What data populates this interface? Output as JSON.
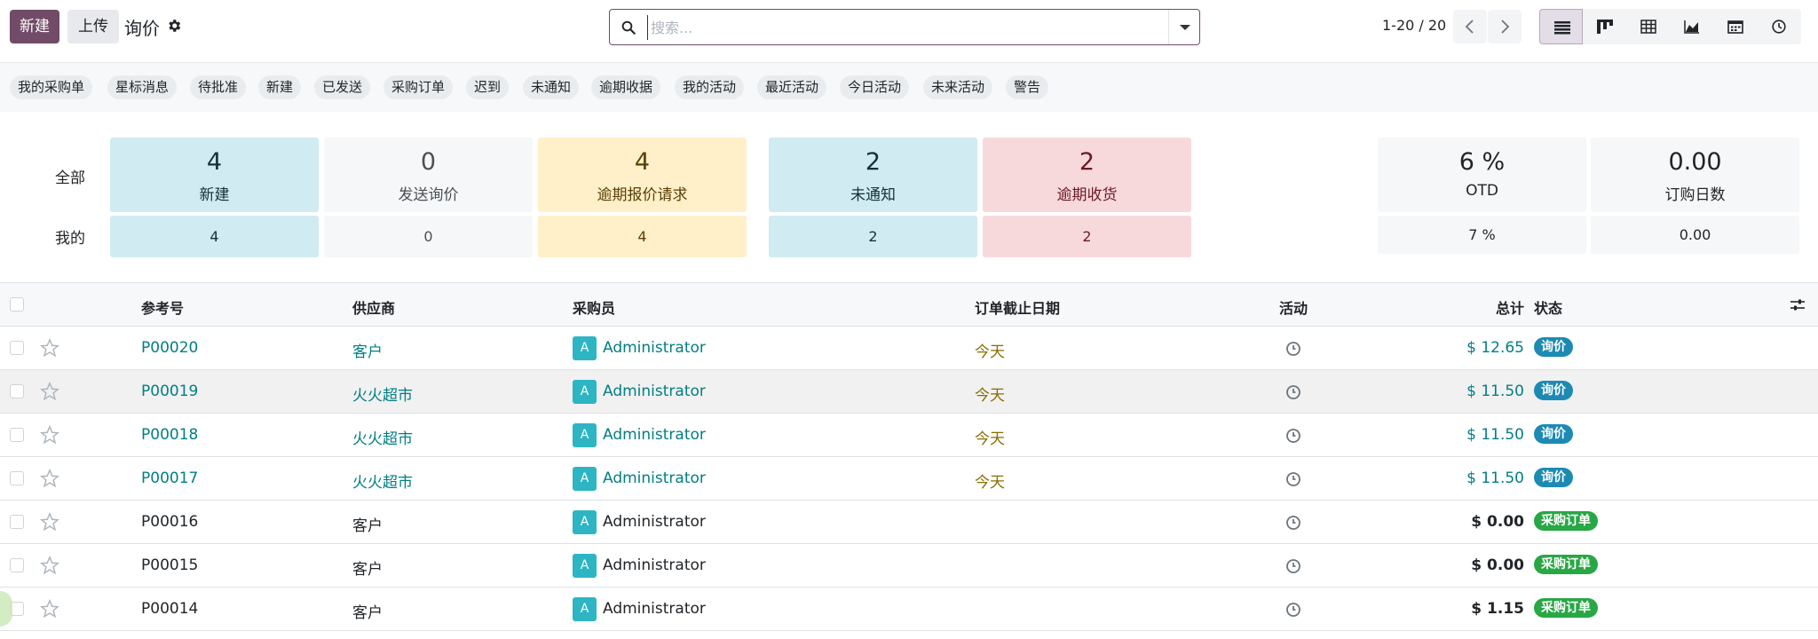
{
  "toolbar": {
    "new_label": "新建",
    "upload_label": "上传",
    "title": "询价"
  },
  "search": {
    "placeholder": "搜索..."
  },
  "pager": {
    "range": "1-20 / 20"
  },
  "views": [
    "list-view-icon",
    "kanban-view-icon",
    "pivot-view-icon",
    "graph-view-icon",
    "calendar-view-icon",
    "activity-view-icon"
  ],
  "filters": [
    "我的采购单",
    "星标消息",
    "待批准",
    "新建",
    "已发送",
    "采购订单",
    "迟到",
    "未通知",
    "逾期收据",
    "我的活动",
    "最近活动",
    "今日活动",
    "未来活动",
    "警告"
  ],
  "dashboard": {
    "all_label": "全部",
    "mine_label": "我的",
    "tiles": [
      {
        "all": "4",
        "label": "新建",
        "mine": "4",
        "tone": "blue"
      },
      {
        "all": "0",
        "label": "发送询价",
        "mine": "0",
        "tone": "gray"
      },
      {
        "all": "4",
        "label": "逾期报价请求",
        "mine": "4",
        "tone": "yellow"
      },
      {
        "all": "2",
        "label": "未通知",
        "mine": "2",
        "tone": "blue"
      },
      {
        "all": "2",
        "label": "逾期收货",
        "mine": "2",
        "tone": "red"
      }
    ],
    "stats": [
      {
        "all": "6 %",
        "label": "OTD",
        "mine": "7 %"
      },
      {
        "all": "0.00",
        "label": "订购日数",
        "mine": "0.00"
      }
    ]
  },
  "table": {
    "headers": {
      "ref": "参考号",
      "vendor": "供应商",
      "buyer": "采购员",
      "deadline": "订单截止日期",
      "activity": "活动",
      "total": "总计",
      "status": "状态"
    },
    "rows": [
      {
        "ref": "P00020",
        "vendor": "客户",
        "avatar": "A",
        "buyer": "Administrator",
        "deadline": "今天",
        "total": "$ 12.65",
        "status": "询价",
        "link": true
      },
      {
        "ref": "P00019",
        "vendor": "火火超市",
        "avatar": "A",
        "buyer": "Administrator",
        "deadline": "今天",
        "total": "$ 11.50",
        "status": "询价",
        "link": true
      },
      {
        "ref": "P00018",
        "vendor": "火火超市",
        "avatar": "A",
        "buyer": "Administrator",
        "deadline": "今天",
        "total": "$ 11.50",
        "status": "询价",
        "link": true
      },
      {
        "ref": "P00017",
        "vendor": "火火超市",
        "avatar": "A",
        "buyer": "Administrator",
        "deadline": "今天",
        "total": "$ 11.50",
        "status": "询价",
        "link": true
      },
      {
        "ref": "P00016",
        "vendor": "客户",
        "avatar": "A",
        "buyer": "Administrator",
        "deadline": "",
        "total": "$ 0.00",
        "status": "采购订单",
        "link": false
      },
      {
        "ref": "P00015",
        "vendor": "客户",
        "avatar": "A",
        "buyer": "Administrator",
        "deadline": "",
        "total": "$ 0.00",
        "status": "采购订单",
        "link": false
      },
      {
        "ref": "P00014",
        "vendor": "客户",
        "avatar": "A",
        "buyer": "Administrator",
        "deadline": "",
        "total": "$ 1.15",
        "status": "采购订单",
        "link": false
      }
    ]
  },
  "colors": {
    "brand": "#714b67",
    "link": "#017e84",
    "rfq_badge": "#1d8ab3",
    "po_badge": "#28a745"
  }
}
